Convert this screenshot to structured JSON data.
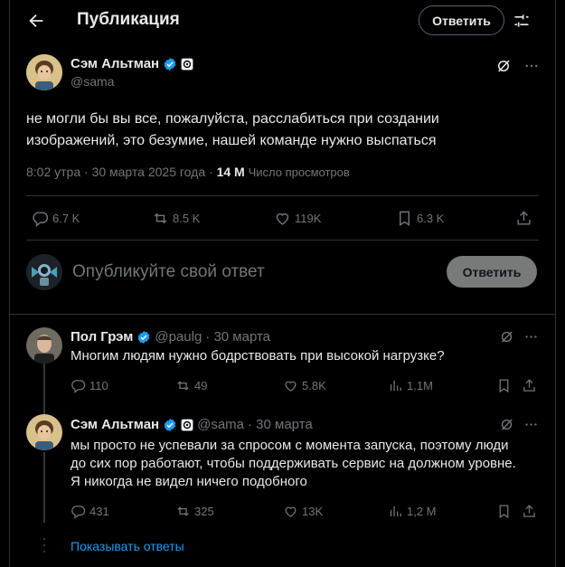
{
  "header": {
    "title": "Публикация",
    "reply_button": "Ответить"
  },
  "post": {
    "author_name": "Сэм Альтман",
    "author_handle": "@sama",
    "text": "не могли бы вы все, пожалуйста, расслабиться при создании изображений, это безумие, нашей команде нужно выспаться",
    "timestamp": "8:02 утра · 30 марта 2025 года · ",
    "views_count": "14 M",
    "views_label": "Число просмотров",
    "stats": {
      "replies": "6.7 K",
      "reposts": "8.5 K",
      "likes": "119K",
      "bookmarks": "6.3 K"
    }
  },
  "composer": {
    "placeholder": "Опубликуйте свой ответ",
    "reply_button": "Ответить"
  },
  "replies": [
    {
      "author_name": "Пол Грэм",
      "author_handle": "@paulg",
      "time": " · 30 марта",
      "text": "Многим людям нужно бодрствовать при высокой нагрузке?",
      "stats": {
        "replies": "110",
        "reposts": "49",
        "likes": "5.8K",
        "views": "1.1M"
      }
    },
    {
      "author_name": "Сэм Альтман",
      "author_handle": "@sama",
      "time": " · 30 марта",
      "text": "мы просто не успевали за спросом с момента запуска, поэтому люди до сих пор работают, чтобы поддерживать сервис на должном уровне. Я никогда не видел ничего подобного",
      "stats": {
        "replies": "431",
        "reposts": "325",
        "likes": "13K",
        "views": "1,2 M"
      }
    }
  ],
  "show_replies": "Показывать ответы",
  "colors": {
    "background": "#000000",
    "verified": "#1d9bf0",
    "link": "#1d9bf0",
    "muted": "#71767b"
  }
}
